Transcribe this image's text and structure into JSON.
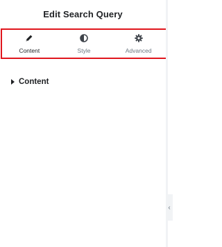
{
  "header": {
    "title": "Edit Search Query"
  },
  "tabs": [
    {
      "label": "Content",
      "icon": "pencil-icon",
      "active": true
    },
    {
      "label": "Style",
      "icon": "half-circle-icon",
      "active": false
    },
    {
      "label": "Advanced",
      "icon": "gear-icon",
      "active": false
    }
  ],
  "section": {
    "title": "Content"
  },
  "sidebar_toggle": {
    "icon": "chevron-left-icon",
    "glyph": "‹"
  },
  "colors": {
    "highlight": "#e0151c",
    "text": "#1f2124",
    "muted": "#6d7882"
  }
}
